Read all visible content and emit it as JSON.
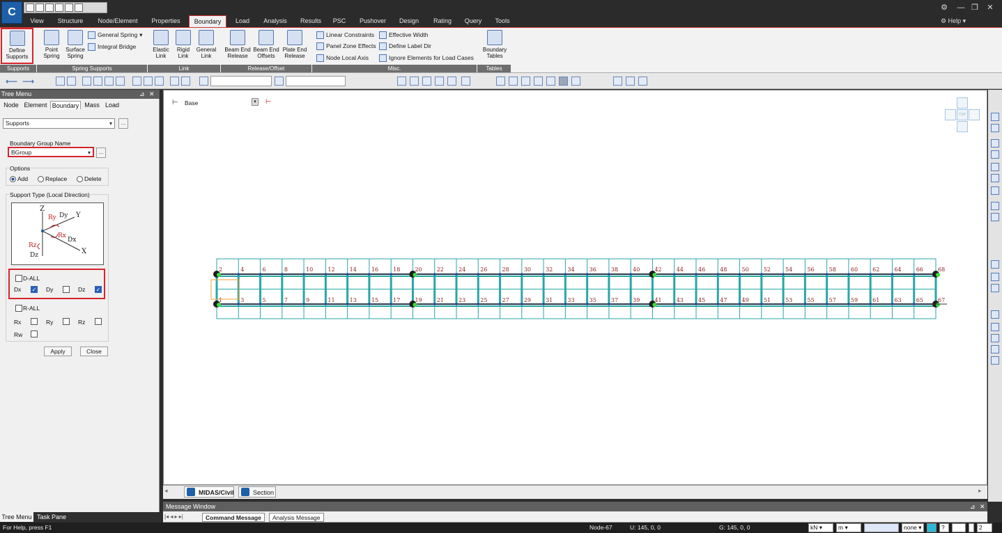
{
  "app": {
    "logo_text": "C"
  },
  "window": {
    "help_label": "Help"
  },
  "ribbon_tabs": [
    "View",
    "Structure",
    "Node/Element",
    "Properties",
    "Boundary",
    "Load",
    "Analysis",
    "Results",
    "PSC",
    "Pushover",
    "Design",
    "Rating",
    "Query",
    "Tools"
  ],
  "ribbon": {
    "define_supports": "Define Supports",
    "supports_group": "Supports",
    "point_spring": "Point Spring",
    "surface_spring": "Surface Spring",
    "general_spring": "General Spring",
    "integral_bridge": "Integral Bridge",
    "spring_supports_group": "Spring Supports",
    "elastic_link": "Elastic Link",
    "rigid_link": "Rigid Link",
    "general_link": "General Link",
    "link_group": "Link",
    "beam_end_release": "Beam End Release",
    "beam_end_offsets": "Beam End Offsets",
    "plate_end_release": "Plate End Release",
    "release_group": "Release/Offset",
    "linear_constraints": "Linear Constraints",
    "panel_zone_effects": "Panel Zone Effects",
    "node_local_axis": "Node Local Axis",
    "effective_width": "Effective Width",
    "define_label_dir": "Define Label Dir",
    "ignore_elements": "Ignore Elements for Load Cases",
    "misc_group": "Misc.",
    "boundary_tables": "Boundary Tables",
    "tables_group": "Tables"
  },
  "tree_menu": {
    "title": "Tree Menu",
    "tabs": [
      "Node",
      "Element",
      "Boundary",
      "Mass",
      "Load"
    ],
    "function_select": "Supports",
    "boundary_group_label": "Boundary Group Name",
    "boundary_group_value": "BGroup",
    "more": "...",
    "options_label": "Options",
    "opt_add": "Add",
    "opt_replace": "Replace",
    "opt_delete": "Delete",
    "support_type_label": "Support Type (Local Direction)",
    "diagram": {
      "z": "Z",
      "y": "Y",
      "x": "X",
      "dy": "Dy",
      "dx": "Dx",
      "dz": "Dz",
      "ry": "Ry",
      "rx": "Rx",
      "rz": "Rz"
    },
    "d_all": "D-ALL",
    "dx": "Dx",
    "dy": "Dy",
    "dz": "Dz",
    "r_all": "R-ALL",
    "rx": "Rx",
    "ry": "Ry",
    "rz": "Rz",
    "rw": "Rw",
    "apply": "Apply",
    "close": "Close",
    "bottom_tabs": [
      "Tree Menu",
      "Task Pane"
    ]
  },
  "viewport": {
    "base_label": "Base",
    "view_tabs": [
      "MIDAS/Civil",
      "Section"
    ],
    "top_label": "TOP",
    "top_nodes": [
      "2",
      "4",
      "6",
      "8",
      "10",
      "12",
      "14",
      "16",
      "18",
      "20",
      "22",
      "24",
      "26",
      "28",
      "30",
      "32",
      "34",
      "36",
      "38",
      "40",
      "42",
      "44",
      "46",
      "48",
      "50",
      "52",
      "54",
      "56",
      "58",
      "60",
      "62",
      "64",
      "66",
      "68"
    ],
    "bottom_nodes": [
      "1",
      "3",
      "5",
      "7",
      "9",
      "11",
      "13",
      "15",
      "17",
      "19",
      "21",
      "23",
      "25",
      "27",
      "29",
      "31",
      "33",
      "35",
      "37",
      "39",
      "41",
      "43",
      "45",
      "47",
      "49",
      "51",
      "53",
      "55",
      "57",
      "59",
      "61",
      "63",
      "65",
      "67"
    ],
    "support_node_indices": [
      0,
      9,
      20,
      33
    ]
  },
  "message_window": {
    "title": "Message Window",
    "tabs": [
      "Command Message",
      "Analysis Message"
    ]
  },
  "status": {
    "help_text": "For Help, press F1",
    "node": "Node-67",
    "u": "U: 145, 0, 0",
    "g": "G: 145, 0, 0",
    "force_unit": "kN",
    "length_unit": "m",
    "none": "none",
    "num": "2"
  }
}
